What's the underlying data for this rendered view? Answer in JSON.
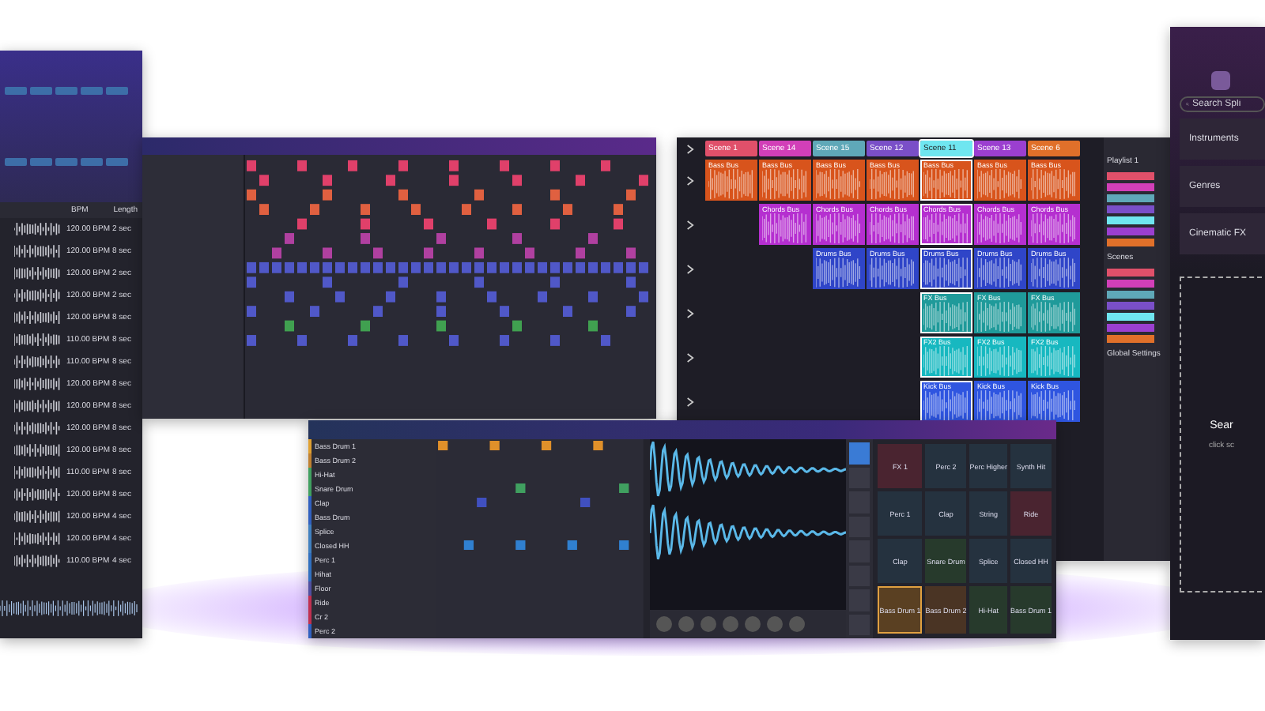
{
  "sample_browser": {
    "columns": [
      "BPM",
      "Length"
    ],
    "rows": [
      {
        "bpm": "120.00 BPM",
        "length": "2 sec"
      },
      {
        "bpm": "120.00 BPM",
        "length": "8 sec"
      },
      {
        "bpm": "120.00 BPM",
        "length": "2 sec"
      },
      {
        "bpm": "120.00 BPM",
        "length": "2 sec"
      },
      {
        "bpm": "120.00 BPM",
        "length": "8 sec"
      },
      {
        "bpm": "110.00 BPM",
        "length": "8 sec"
      },
      {
        "bpm": "110.00 BPM",
        "length": "8 sec"
      },
      {
        "bpm": "120.00 BPM",
        "length": "8 sec"
      },
      {
        "bpm": "120.00 BPM",
        "length": "8 sec"
      },
      {
        "bpm": "120.00 BPM",
        "length": "8 sec"
      },
      {
        "bpm": "120.00 BPM",
        "length": "8 sec"
      },
      {
        "bpm": "110.00 BPM",
        "length": "8 sec"
      },
      {
        "bpm": "120.00 BPM",
        "length": "8 sec"
      },
      {
        "bpm": "120.00 BPM",
        "length": "4 sec"
      },
      {
        "bpm": "120.00 BPM",
        "length": "4 sec"
      },
      {
        "bpm": "110.00 BPM",
        "length": "4 sec"
      }
    ]
  },
  "clip_launcher": {
    "scenes": [
      {
        "label": "Scene 1",
        "color": "#e0506a",
        "selected": false
      },
      {
        "label": "Scene 14",
        "color": "#d23fb8",
        "selected": false
      },
      {
        "label": "Scene 15",
        "color": "#5fa8b8",
        "selected": false
      },
      {
        "label": "Scene 12",
        "color": "#7a4fc8",
        "selected": false
      },
      {
        "label": "Scene 11",
        "color": "#6fe6f0",
        "selected": true
      },
      {
        "label": "Scene 13",
        "color": "#9b3fd0",
        "selected": false
      },
      {
        "label": "Scene 6",
        "color": "#e0702a",
        "selected": false
      }
    ],
    "tracks": [
      {
        "color": "#d8541c",
        "clips": [
          "Bass Bus",
          "Bass Bus",
          "Bass Bus",
          "Bass Bus",
          "Bass Bus",
          "Bass Bus",
          "Bass Bus"
        ]
      },
      {
        "color": "#b52fd0",
        "clips": [
          "Chords Bus",
          "Chords Bus",
          "Chords Bus",
          "Chords Bus",
          "Chords Bus",
          "Chords Bus"
        ]
      },
      {
        "color": "#2f45c8",
        "clips": [
          "Drums Bus",
          "Drums Bus",
          "Drums Bus",
          "Drums Bus",
          "Drums Bus"
        ]
      },
      {
        "color": "#1f9a9a",
        "clips": [
          "FX Bus",
          "FX Bus",
          "FX Bus"
        ]
      },
      {
        "color": "#17b8c0",
        "clips": [
          "FX2 Bus",
          "FX2 Bus",
          "FX2 Bus"
        ]
      },
      {
        "color": "#2f55e0",
        "clips": [
          "Kick Bus",
          "Kick Bus",
          "Kick Bus"
        ]
      }
    ],
    "panel": {
      "playlist": "Playlist 1",
      "scenes_heading": "Scenes",
      "settings_heading": "Global Settings"
    }
  },
  "drum_machine": {
    "tracks": [
      {
        "name": "Bass Drum 1",
        "color": "#e0a030"
      },
      {
        "name": "Bass Drum 2",
        "color": "#c08030"
      },
      {
        "name": "Hi-Hat",
        "color": "#40a060"
      },
      {
        "name": "Snare Drum",
        "color": "#40a060"
      },
      {
        "name": "Clap",
        "color": "#3060c0"
      },
      {
        "name": "Bass Drum",
        "color": "#3060c0"
      },
      {
        "name": "Splice",
        "color": "#4080c0"
      },
      {
        "name": "Closed HH",
        "color": "#4080c0"
      },
      {
        "name": "Perc 1",
        "color": "#3070c0"
      },
      {
        "name": "Hihat",
        "color": "#3070c0"
      },
      {
        "name": "Floor",
        "color": "#5050a0"
      },
      {
        "name": "Ride",
        "color": "#c03050"
      },
      {
        "name": "Cr 2",
        "color": "#c03050"
      },
      {
        "name": "Perc 2",
        "color": "#3060c0"
      }
    ],
    "pads": [
      {
        "label": "FX 1",
        "color": "#4a2430",
        "selected": false
      },
      {
        "label": "Perc 2",
        "color": "#25323f",
        "selected": false
      },
      {
        "label": "Perc Higher",
        "color": "#25323f",
        "selected": false
      },
      {
        "label": "Synth Hit",
        "color": "#25323f",
        "selected": false
      },
      {
        "label": "Perc 1",
        "color": "#25323f",
        "selected": false
      },
      {
        "label": "Clap",
        "color": "#25323f",
        "selected": false
      },
      {
        "label": "String",
        "color": "#25323f",
        "selected": false
      },
      {
        "label": "Ride",
        "color": "#4a2430",
        "selected": false
      },
      {
        "label": "Clap",
        "color": "#25323f",
        "selected": false
      },
      {
        "label": "Snare Drum",
        "color": "#273a2c",
        "selected": false
      },
      {
        "label": "Splice",
        "color": "#25323f",
        "selected": false
      },
      {
        "label": "Closed HH",
        "color": "#25323f",
        "selected": false
      },
      {
        "label": "Bass Drum 1",
        "color": "#5a4022",
        "selected": true
      },
      {
        "label": "Bass Drum 2",
        "color": "#4a3424",
        "selected": false
      },
      {
        "label": "Hi-Hat",
        "color": "#273a2c",
        "selected": false
      },
      {
        "label": "Bass Drum 1",
        "color": "#273a2c",
        "selected": false
      }
    ]
  },
  "splice_panel": {
    "search_placeholder": "Search Spli",
    "categories": [
      "Instruments",
      "Genres",
      "Cinematic FX"
    ],
    "empty_title": "Sear",
    "empty_hint": "click sc"
  }
}
